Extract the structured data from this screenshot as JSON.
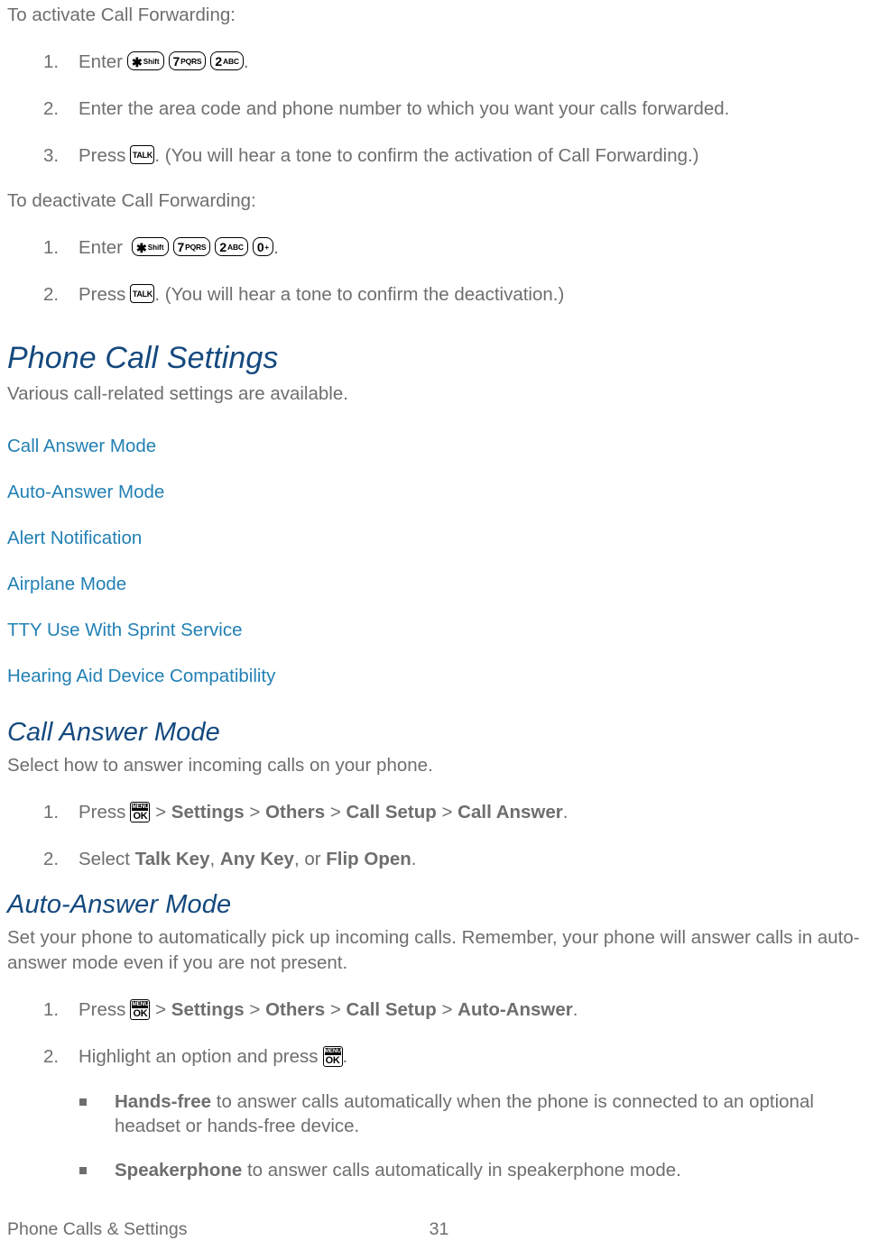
{
  "document": {
    "footer": {
      "chapter": "Phone Calls & Settings",
      "page_number": "31"
    }
  },
  "activate_section": {
    "intro": "To activate Call Forwarding:",
    "steps": [
      {
        "num": "1.",
        "prefix": "Enter",
        "keys": [
          "star-shift-key",
          "seven-pqrs-key",
          "two-abc-key"
        ],
        "suffix": "."
      },
      {
        "num": "2.",
        "text": "Enter the area code and phone number to which you want your calls forwarded."
      },
      {
        "num": "3.",
        "prefix": "Press",
        "keys": [
          "talk-key"
        ],
        "suffix": ". (You will hear a tone to confirm the activation of Call Forwarding.)"
      }
    ]
  },
  "deactivate_section": {
    "intro": "To deactivate Call Forwarding:",
    "steps": [
      {
        "num": "1.",
        "prefix": "Enter",
        "keys": [
          "star-shift-key",
          "seven-pqrs-key",
          "two-abc-key",
          "zero-plus-key"
        ],
        "suffix": "."
      },
      {
        "num": "2.",
        "prefix": "Press",
        "keys": [
          "talk-key"
        ],
        "suffix": ". (You will hear a tone to confirm the deactivation.)"
      }
    ]
  },
  "phone_call_settings": {
    "heading": "Phone Call Settings",
    "description": "Various call-related settings are available.",
    "links": [
      "Call Answer Mode",
      "Auto-Answer Mode",
      "Alert Notification",
      "Airplane Mode",
      "TTY Use With Sprint Service",
      "Hearing Aid Device Compatibility"
    ]
  },
  "call_answer_mode": {
    "heading": "Call Answer Mode",
    "description": "Select how to answer incoming calls on your phone.",
    "step1": {
      "num": "1.",
      "prefix": "Press",
      "sep": ">",
      "path": [
        "Settings",
        "Others",
        "Call Setup",
        "Call Answer"
      ],
      "suffix": "."
    },
    "step2": {
      "num": "2.",
      "prefix": "Select",
      "option1": "Talk Key",
      "comma1": ",",
      "option2": "Any Key",
      "joiner": ", or",
      "option3": "Flip Open",
      "suffix": "."
    }
  },
  "auto_answer_mode": {
    "heading": "Auto-Answer Mode",
    "description": "Set your phone to automatically pick up incoming calls. Remember, your phone will answer calls in auto-answer mode even if you are not present.",
    "step1": {
      "num": "1.",
      "prefix": "Press",
      "sep": ">",
      "path": [
        "Settings",
        "Others",
        "Call Setup",
        "Auto-Answer"
      ],
      "suffix": "."
    },
    "step2": {
      "num": "2.",
      "prefix": "Highlight an option and press",
      "suffix": "."
    },
    "options": [
      {
        "label": "Hands-free",
        "text": "to answer calls automatically when the phone is connected to an optional headset or hands-free device."
      },
      {
        "label": "Speakerphone",
        "text": "to answer calls automatically in speakerphone mode."
      }
    ]
  },
  "key_glyphs": {
    "star_shift": {
      "symbol": "✱",
      "label": "Shift"
    },
    "seven_pqrs": {
      "digit": "7",
      "label": "PQRS"
    },
    "two_abc": {
      "digit": "2",
      "label": "ABC"
    },
    "zero_plus": {
      "digit": "0",
      "label": "+"
    },
    "talk": {
      "label": "TALK"
    },
    "menu_ok": {
      "top": "MENU",
      "bottom": "OK"
    }
  },
  "colors": {
    "heading_blue": "#14497e",
    "link_blue": "#2280b4",
    "body_gray": "#6d6e70"
  }
}
